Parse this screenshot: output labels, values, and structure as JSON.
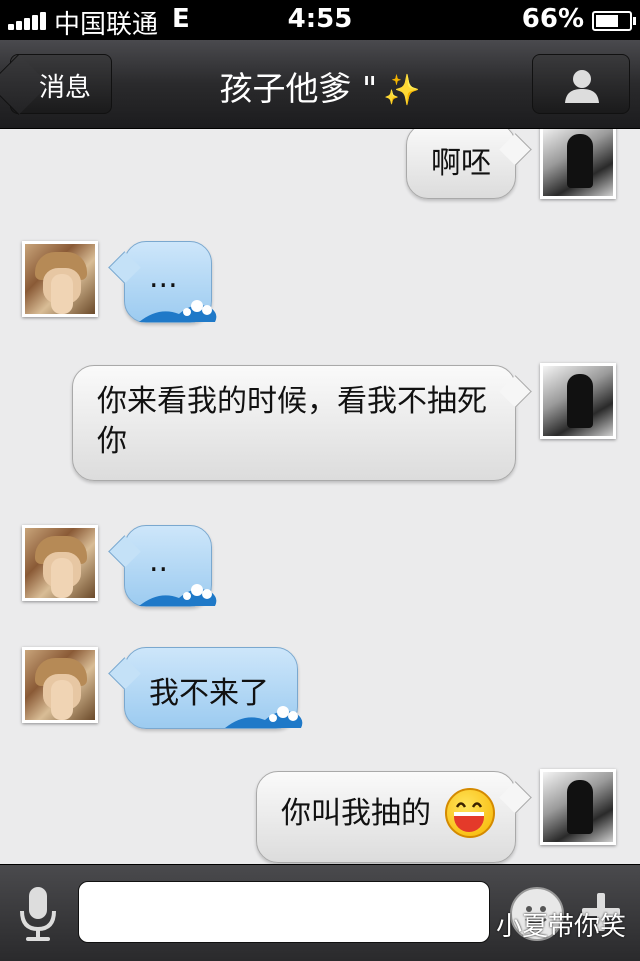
{
  "status_bar": {
    "carrier": "中国联通",
    "network": "E",
    "time": "4:55",
    "battery": "66%"
  },
  "nav": {
    "back_label": "消息",
    "title": "孩子他爹 \"",
    "sparkle": "✨",
    "profile_icon": "person-icon"
  },
  "messages": [
    {
      "side": "out",
      "text": "啊呸"
    },
    {
      "side": "in",
      "text": "..."
    },
    {
      "side": "out",
      "text": "你来看我的时候，看我不抽死你"
    },
    {
      "side": "in",
      "text": ".."
    },
    {
      "side": "in",
      "text": "我不来了"
    },
    {
      "side": "out",
      "text": "你叫我抽的",
      "emoji": "grinning-emoji"
    }
  ],
  "input": {
    "value": "",
    "mic_icon": "microphone-icon",
    "emoji_icon": "emoji-icon",
    "plus_icon": "plus-icon"
  },
  "watermark": "小夏带你笑",
  "colors": {
    "incoming_bubble": "#9ccbf0",
    "outgoing_bubble": "#dcdcdc",
    "nav_bar": "#2a2a2c"
  }
}
